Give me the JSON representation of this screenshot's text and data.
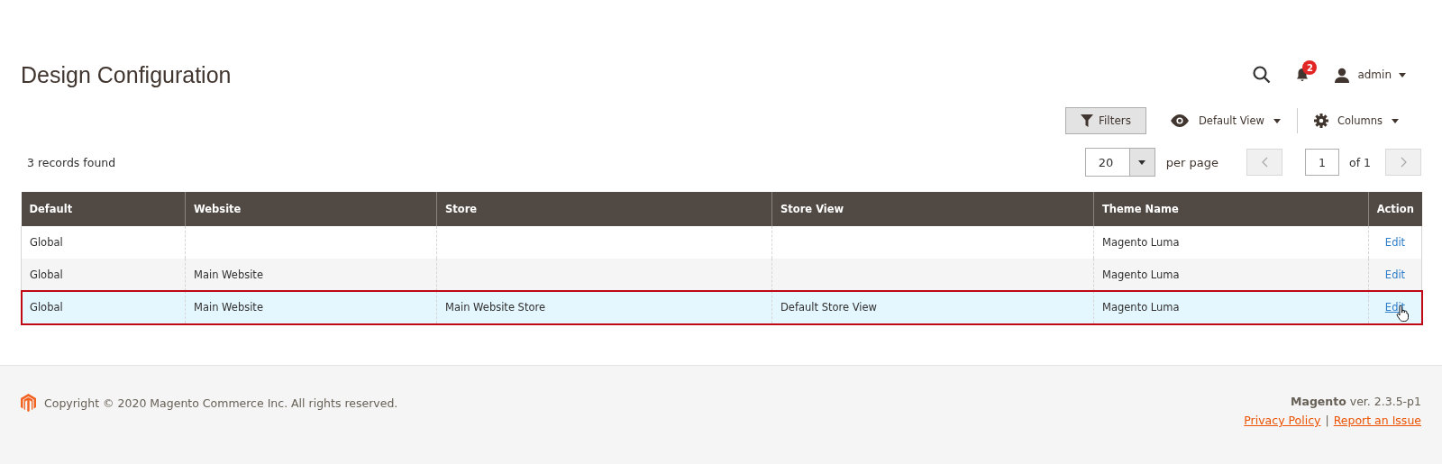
{
  "page_title": "Design Configuration",
  "header": {
    "notifications_count": "2",
    "user": "admin"
  },
  "toolbar": {
    "filters": "Filters",
    "view": "Default View",
    "columns": "Columns"
  },
  "records_found": "3 records found",
  "pager": {
    "per_page_value": "20",
    "per_page_label": "per page",
    "page": "1",
    "of_pages": "of 1"
  },
  "table": {
    "columns": [
      "Default",
      "Website",
      "Store",
      "Store View",
      "Theme Name",
      "Action"
    ],
    "rows": [
      {
        "cells": [
          "Global",
          "",
          "",
          "",
          "Magento Luma"
        ],
        "action": "Edit",
        "selected": false
      },
      {
        "cells": [
          "Global",
          "Main Website",
          "",
          "",
          "Magento Luma"
        ],
        "action": "Edit",
        "selected": false
      },
      {
        "cells": [
          "Global",
          "Main Website",
          "Main Website Store",
          "Default Store View",
          "Magento Luma"
        ],
        "action": "Edit",
        "selected": true
      }
    ]
  },
  "footer": {
    "copyright": "Copyright © 2020 Magento Commerce Inc. All rights reserved.",
    "version": "**Magento** ver. 2.3.5-p1",
    "links": [
      "Privacy Policy",
      "Report an Issue"
    ],
    "separator": "|"
  }
}
